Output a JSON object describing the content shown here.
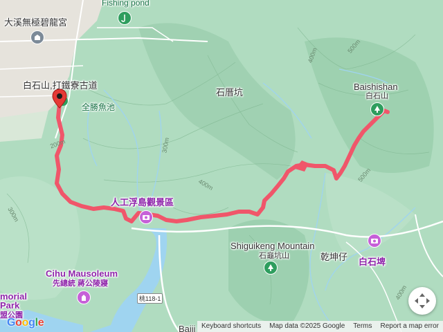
{
  "labels": {
    "temple": "大溪無極碧龍宮",
    "fishing_pond": "Fishing pond",
    "trailhead": "白石山,打鐵寮古道",
    "quansheng_pond": "全勝魚池",
    "shicuokeng": "石厝坑",
    "baishishan_en": "Baishishan",
    "baishishan_zh": "白石山",
    "island_viewpoint": "人工浮島觀景區",
    "shiguikeng_en": "Shiguikeng Mountain",
    "shiguikeng_zh": "石龜坑山",
    "qiankunzi": "乾坤仔",
    "baishipi": "白石埤",
    "cihu_en": "Cihu Mausoleum",
    "cihu_zh": "先總統 蔣公陵寢",
    "memorial_en1": "morial",
    "memorial_en2": "Park",
    "memorial_zh": "盟公園",
    "baiji": "Baiji",
    "route_shield": "桃118-1"
  },
  "contours": {
    "c200": "200m",
    "c300a": "300m",
    "c300b": "300m",
    "c400a": "400m",
    "c400b": "400m",
    "c500a": "500m",
    "c500b": "500m",
    "c400c": "400m"
  },
  "attribution": {
    "shortcuts": "Keyboard shortcuts",
    "map_data": "Map data ©2025 Google",
    "terms": "Terms",
    "report": "Report a map error"
  },
  "logo": {
    "g1": "G",
    "o1": "o",
    "o2": "o",
    "g2": "g",
    "l": "l",
    "e": "e"
  },
  "colors": {
    "track": "#f0566a",
    "water": "#9fd4f0",
    "terrain": "#a8d8b9",
    "poi_green": "#177245",
    "poi_purple": "#8e24aa"
  },
  "icons": {
    "trail_pin": "red-location-pin-icon",
    "park_pin": "tree-icon",
    "attraction_pin": "camera-icon",
    "nav_control": "pan-arrows-icon"
  }
}
